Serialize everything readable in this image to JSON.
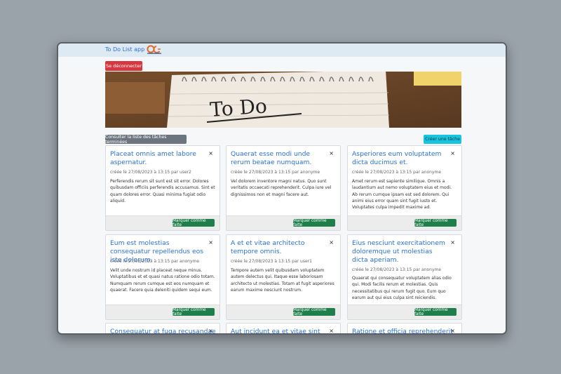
{
  "app": {
    "title": "To Do List app"
  },
  "header": {
    "logout_label": "Se déconnecter"
  },
  "banner": {
    "image_text": "To Do"
  },
  "actions": {
    "finished_list_label": "Consulter la liste des tâches terminées",
    "create_task_label": "Créer une tâche"
  },
  "tasks": [
    {
      "title": "Placeat omnis amet labore aspernatur.",
      "meta": "créée le 27/08/2023 à 13:15 par user2",
      "content": "Perferendis rerum sit sunt est sit error. Dolores quibusdam officiis perferendis accusamus. Sint et quam dolores error. Quasi minima fugiat odio aliquid.",
      "button": "Marquer comme faite"
    },
    {
      "title": "Quaerat esse modi unde rerum beatae numquam.",
      "meta": "créée le 27/08/2023 à 13:15 par anonyme",
      "content": "Vel dolorem inventore magni natus. Quo sunt veritatis occaecati reprehenderit. Culpa iure vel dignissimos non et magni facere aut.",
      "button": "Marquer comme faite"
    },
    {
      "title": "Asperiores eum voluptatem dicta ducimus et.",
      "meta": "créée le 27/08/2023 à 13:15 par anonyme",
      "content": "Amet rerum est sapiente similique. Omnis a laudantium aut nemo voluptatem eius et modi. Ab rerum cumque ipsam est sed dolorem. Qui animi eius error quam sint fugit iusto et. Voluptates culpa impedit maxime ad.",
      "button": "Marquer comme faite"
    },
    {
      "title": "Eum est molestias consequatur repellendus eos iste dolorum.",
      "meta": "créée le 27/08/2023 à 13:15 par anonyme",
      "content": "Velit unde nostrum id placeat neque minus. Voluptatibus et et quasi natus ratione odio totam. Numquam rerum cumque est eos numquam et quaerat. Facere quia deleniti quidem sequi eum.",
      "button": "Marquer comme faite"
    },
    {
      "title": "A et et vitae architecto tempore omnis.",
      "meta": "créée le 27/08/2023 à 13:15 par user1",
      "content": "Tempore autem velit quibusdam voluptatem autem delectus qui. Itaque esse laboriosam architecto ut molestias. Totam at fugit asperiores earum maxime nesciunt nostrum.",
      "button": "Marquer comme faite"
    },
    {
      "title": "Eius nesciunt exercitationem doloremque ut molestias dicta aperiam.",
      "meta": "créée le 27/08/2023 à 13:15 par anonyme",
      "content": "Quaerat qui consequatur voluptatem alias odio qui. Modi facilis rerum et molestias. Quis necessitatibus qui rerum fugit quo. Eum quo earum aut qui eius culpa sint reiciendis.",
      "button": "Marquer comme faite"
    },
    {
      "title": "Consequatur at fuga recusandae"
    },
    {
      "title": "Aut incidunt ea et vitae sint"
    },
    {
      "title": "Ratione et officia reprehenderit"
    }
  ],
  "icons": {
    "close": "×"
  }
}
